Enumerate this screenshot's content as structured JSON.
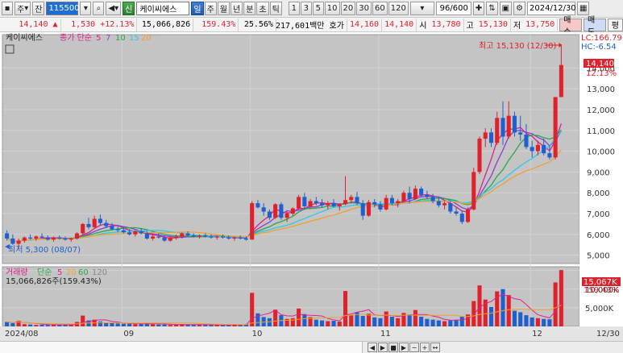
{
  "toolbar": {
    "mode1": "주",
    "mode2": "잔",
    "code": "115500",
    "tag": "신",
    "stock_name": "케이씨에스",
    "periods": [
      "일",
      "주",
      "월",
      "년",
      "분",
      "초",
      "틱"
    ],
    "active_period": "일",
    "intervals": [
      "1",
      "3",
      "5",
      "10",
      "20",
      "30",
      "60",
      "120"
    ],
    "counter": "96/600",
    "date": "2024/12/30"
  },
  "quote": {
    "price": "14,140",
    "arrow": "▲",
    "change": "1,530",
    "change_pct": "+12.13%",
    "volume": "15,066,826",
    "volume_pct": "159.43%",
    "turnover": "25.56%",
    "amount": "217,601백만",
    "bid_label": "호가",
    "bid": "14,160",
    "ask": "14,140",
    "open_label": "시",
    "open": "13,780",
    "high_label": "고",
    "high": "15,130",
    "low_label": "저",
    "low": "13,750",
    "buy_label": "매수",
    "sell_label": "매도",
    "eval_label": "평"
  },
  "legend": {
    "price_name": "케이씨에스",
    "ma_title": "종가 단순",
    "ma_periods": [
      "5",
      "7",
      "10",
      "15",
      "20"
    ],
    "vol_title": "거래량",
    "vol_ma_title": "단순",
    "vol_ma_periods": [
      "5",
      "20",
      "60",
      "120"
    ],
    "vol_value": "15,066,826주(159.43%)"
  },
  "annotations": {
    "high": "최고 15,130 (12/30)",
    "low": "최저 5,300 (08/07)",
    "lc": "LC:166.79",
    "hc": "HC:-6.54",
    "last_price": "14,140",
    "last_pct": "12.13%",
    "last_vol": "15,067K",
    "last_vol_pct": "159.43%"
  },
  "colors": {
    "up": "#e0202a",
    "down": "#1f5fd0",
    "ma5": "#e0208a",
    "ma7": "#8a3fd0",
    "ma10": "#2aa84a",
    "ma15": "#30c8e8",
    "ma20": "#f0a030",
    "bg": "#c4c4c4"
  },
  "chart_data": {
    "type": "candlestick",
    "y_ticks": [
      "14,000",
      "13,000",
      "12,000",
      "11,000",
      "10,000",
      "9,000",
      "8,000",
      "7,000",
      "6,000",
      "5,000"
    ],
    "vol_ticks": [
      "15,000K",
      "10,000K",
      "5,000K"
    ],
    "x_labels": [
      "2024/08",
      "09",
      "10",
      "11",
      "12",
      "12/30"
    ],
    "candles": [
      [
        6050,
        6200,
        5700,
        5800
      ],
      [
        5800,
        6000,
        5500,
        5550
      ],
      [
        5550,
        5800,
        5300,
        5700
      ],
      [
        5700,
        5900,
        5600,
        5850
      ],
      [
        5850,
        6000,
        5750,
        5800
      ],
      [
        5800,
        5950,
        5700,
        5900
      ],
      [
        5900,
        6050,
        5800,
        5850
      ],
      [
        5850,
        5950,
        5700,
        5750
      ],
      [
        5750,
        5900,
        5650,
        5850
      ],
      [
        5850,
        5950,
        5750,
        5800
      ],
      [
        5800,
        5900,
        5700,
        5750
      ],
      [
        5750,
        5850,
        5650,
        5800
      ],
      [
        5800,
        6100,
        5750,
        6050
      ],
      [
        6050,
        6550,
        6000,
        6500
      ],
      [
        6500,
        6800,
        6250,
        6350
      ],
      [
        6350,
        6900,
        6300,
        6750
      ],
      [
        6750,
        6950,
        6450,
        6550
      ],
      [
        6550,
        6700,
        6300,
        6400
      ],
      [
        6400,
        6550,
        6200,
        6250
      ],
      [
        6250,
        6400,
        6100,
        6200
      ],
      [
        6200,
        6350,
        6050,
        6100
      ],
      [
        6100,
        6250,
        5950,
        6000
      ],
      [
        6000,
        6200,
        5900,
        6150
      ],
      [
        6150,
        6300,
        6000,
        6050
      ],
      [
        6050,
        6150,
        5750,
        5800
      ],
      [
        5800,
        6000,
        5700,
        5900
      ],
      [
        5900,
        6050,
        5800,
        5850
      ],
      [
        5850,
        5950,
        5650,
        5700
      ],
      [
        5700,
        5900,
        5650,
        5850
      ],
      [
        5850,
        6000,
        5750,
        5900
      ],
      [
        5900,
        6100,
        5800,
        6050
      ],
      [
        6050,
        6150,
        5900,
        5950
      ],
      [
        5950,
        6050,
        5850,
        5900
      ],
      [
        5900,
        6000,
        5800,
        5950
      ],
      [
        5950,
        6050,
        5850,
        5900
      ],
      [
        5900,
        6000,
        5800,
        5850
      ],
      [
        5850,
        5950,
        5750,
        5900
      ],
      [
        5900,
        6000,
        5800,
        5850
      ],
      [
        5850,
        5950,
        5750,
        5800
      ],
      [
        5800,
        5900,
        5700,
        5850
      ],
      [
        5850,
        5950,
        5750,
        5800
      ],
      [
        5800,
        5900,
        5700,
        5750
      ],
      [
        5750,
        7600,
        5750,
        7500
      ],
      [
        7500,
        7650,
        7250,
        7300
      ],
      [
        7300,
        7500,
        6900,
        7100
      ],
      [
        7100,
        7200,
        6700,
        6800
      ],
      [
        6800,
        7500,
        6750,
        7450
      ],
      [
        7450,
        7550,
        6700,
        6800
      ],
      [
        6800,
        7100,
        6600,
        7000
      ],
      [
        7000,
        7300,
        6900,
        7250
      ],
      [
        7250,
        7900,
        7200,
        7800
      ],
      [
        7800,
        8000,
        7200,
        7350
      ],
      [
        7350,
        7700,
        7250,
        7600
      ],
      [
        7600,
        7800,
        7400,
        7500
      ],
      [
        7500,
        7700,
        7300,
        7400
      ],
      [
        7400,
        7600,
        7200,
        7500
      ],
      [
        7500,
        7700,
        7300,
        7350
      ],
      [
        7350,
        7500,
        7150,
        7450
      ],
      [
        7450,
        8800,
        7400,
        7650
      ],
      [
        7650,
        7900,
        7500,
        7800
      ],
      [
        7800,
        8050,
        7400,
        7500
      ],
      [
        7500,
        7650,
        6700,
        6900
      ],
      [
        6900,
        7650,
        6850,
        7550
      ],
      [
        7550,
        7700,
        7300,
        7450
      ],
      [
        7450,
        7600,
        7100,
        7200
      ],
      [
        7200,
        7900,
        7150,
        7750
      ],
      [
        7750,
        7900,
        7400,
        7500
      ],
      [
        7500,
        7700,
        7300,
        7600
      ],
      [
        7600,
        8100,
        7550,
        8000
      ],
      [
        8000,
        8300,
        7500,
        7700
      ],
      [
        7700,
        8350,
        7650,
        8200
      ],
      [
        8200,
        8300,
        7800,
        7900
      ],
      [
        7900,
        8100,
        7700,
        7800
      ],
      [
        7800,
        7950,
        7500,
        7600
      ],
      [
        7600,
        7800,
        7300,
        7400
      ],
      [
        7400,
        7600,
        7200,
        7500
      ],
      [
        7500,
        7600,
        7000,
        7100
      ],
      [
        7100,
        7300,
        6900,
        7000
      ],
      [
        7000,
        7150,
        6500,
        6600
      ],
      [
        6600,
        7300,
        6550,
        7200
      ],
      [
        7200,
        9200,
        7150,
        9000
      ],
      [
        9000,
        10700,
        8900,
        10600
      ],
      [
        10600,
        11100,
        10200,
        10900
      ],
      [
        10900,
        11100,
        10200,
        10400
      ],
      [
        10400,
        11900,
        10300,
        11600
      ],
      [
        11600,
        12400,
        10300,
        10700
      ],
      [
        10700,
        12400,
        10600,
        11700
      ],
      [
        11700,
        11900,
        10700,
        10900
      ],
      [
        10900,
        11700,
        10500,
        10800
      ],
      [
        10800,
        11300,
        10100,
        10200
      ],
      [
        10200,
        10500,
        9700,
        10000
      ],
      [
        10000,
        10500,
        9800,
        10300
      ],
      [
        10300,
        10600,
        9800,
        9900
      ],
      [
        9900,
        10300,
        9600,
        9700
      ],
      [
        9700,
        12600,
        9600,
        12600
      ],
      [
        12600,
        15130,
        13750,
        14140
      ]
    ],
    "volumes": [
      1.2,
      0.9,
      1.5,
      0.6,
      0.5,
      0.4,
      0.5,
      0.4,
      0.5,
      0.4,
      0.4,
      0.5,
      1.2,
      2.9,
      1.6,
      1.8,
      1.3,
      1.0,
      0.9,
      0.8,
      0.7,
      0.7,
      0.6,
      0.7,
      0.9,
      0.6,
      0.5,
      0.5,
      0.4,
      0.5,
      0.6,
      0.5,
      0.4,
      0.4,
      0.5,
      0.4,
      0.4,
      0.4,
      0.5,
      0.4,
      0.4,
      0.5,
      9.0,
      3.5,
      2.5,
      2.2,
      4.5,
      3.0,
      2.0,
      2.2,
      4.8,
      3.3,
      2.5,
      1.8,
      1.6,
      1.4,
      1.5,
      1.3,
      9.5,
      3.0,
      3.8,
      2.8,
      3.4,
      2.4,
      2.2,
      4.0,
      2.6,
      2.2,
      3.6,
      3.2,
      4.4,
      2.6,
      2.0,
      1.8,
      1.6,
      1.4,
      1.6,
      1.8,
      2.6,
      3.2,
      6.8,
      11.0,
      7.2,
      5.2,
      9.4,
      10.0,
      8.4,
      4.2,
      3.8,
      3.0,
      2.4,
      2.2,
      2.0,
      1.9,
      11.8,
      15.1
    ]
  }
}
